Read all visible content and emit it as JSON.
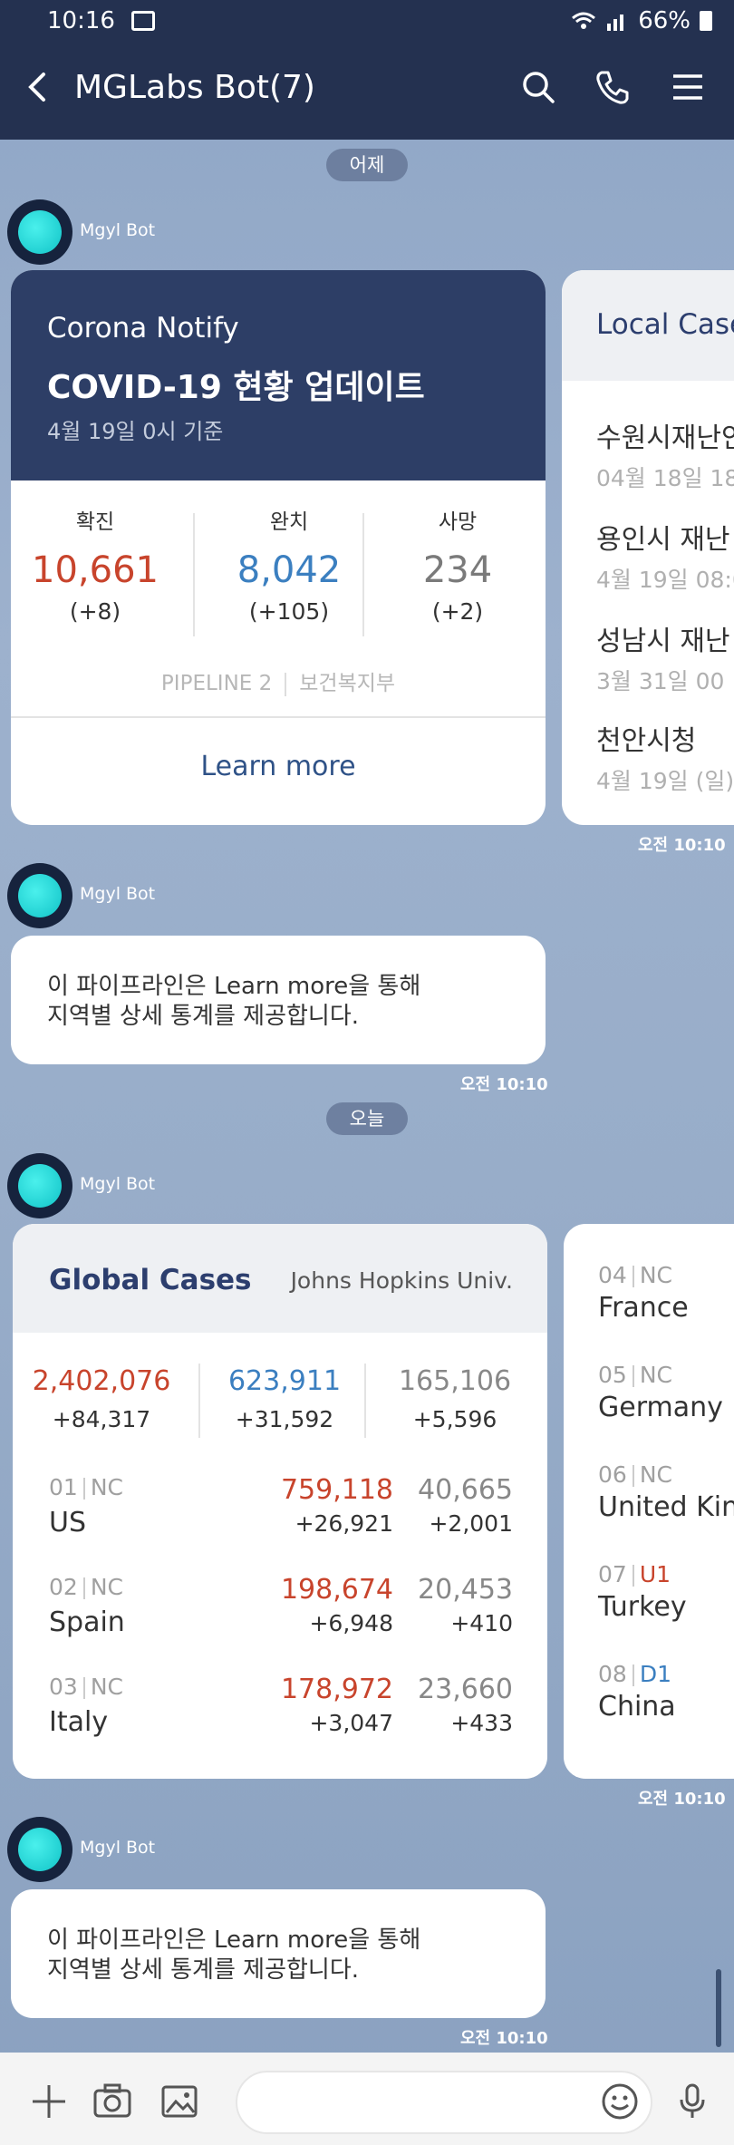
{
  "status_bar": {
    "time": "10:16",
    "battery": "66%"
  },
  "header": {
    "title": "MGLabs Bot(7)"
  },
  "dates": {
    "yesterday": "어제",
    "today": "오늘"
  },
  "sender_name": "Mgyl Bot",
  "corona_card": {
    "app": "Corona Notify",
    "headline": "COVID-19 현황 업데이트",
    "subtitle": "4월 19일 0시 기준",
    "stats": [
      {
        "label": "확진",
        "value": "10,661",
        "delta": "(+8)",
        "color": "#c8442c"
      },
      {
        "label": "완치",
        "value": "8,042",
        "delta": "(+105)",
        "color": "#3b7fc0"
      },
      {
        "label": "사망",
        "value": "234",
        "delta": "(+2)",
        "color": "#7a7a7a"
      }
    ],
    "footer_left": "PIPELINE 2",
    "footer_right": "보건복지부",
    "learn_more": "Learn more"
  },
  "local_card": {
    "title": "Local Case",
    "items": [
      {
        "name": "수원시재난안",
        "date": "04월 18일 18"
      },
      {
        "name": "용인시 재난",
        "date": "4월 19일 08:0"
      },
      {
        "name": "성남시 재난",
        "date": "3월 31일 00 :"
      },
      {
        "name": "천안시청",
        "date": "4월 19일 (일)"
      }
    ]
  },
  "message_text_line1": "이 파이프라인은 Learn more을 통해",
  "message_text_line2": "지역별 상세 통계를 제공합니다.",
  "timestamp": "오전 10:10",
  "global_card": {
    "title": "Global Cases",
    "source": "Johns Hopkins Univ.",
    "summary": [
      {
        "value": "2,402,076",
        "delta": "+84,317",
        "color": "#c8442c"
      },
      {
        "value": "623,911",
        "delta": "+31,592",
        "color": "#3b7fc0"
      },
      {
        "value": "165,106",
        "delta": "+5,596",
        "color": "#888888"
      }
    ],
    "rows": [
      {
        "rank": "01",
        "tag": "NC",
        "country": "US",
        "cases": "759,118",
        "cases_delta": "+26,921",
        "deaths": "40,665",
        "deaths_delta": "+2,001"
      },
      {
        "rank": "02",
        "tag": "NC",
        "country": "Spain",
        "cases": "198,674",
        "cases_delta": "+6,948",
        "deaths": "20,453",
        "deaths_delta": "+410"
      },
      {
        "rank": "03",
        "tag": "NC",
        "country": "Italy",
        "cases": "178,972",
        "cases_delta": "+3,047",
        "deaths": "23,660",
        "deaths_delta": "+433"
      }
    ]
  },
  "global_card_2": {
    "rows": [
      {
        "rank": "04",
        "tag": "NC",
        "country": "France",
        "tag_color": "#a0a0a0"
      },
      {
        "rank": "05",
        "tag": "NC",
        "country": "Germany",
        "tag_color": "#a0a0a0"
      },
      {
        "rank": "06",
        "tag": "NC",
        "country": "United Kin",
        "tag_color": "#a0a0a0"
      },
      {
        "rank": "07",
        "tag": "U1",
        "country": "Turkey",
        "tag_color": "#c8442c"
      },
      {
        "rank": "08",
        "tag": "D1",
        "country": "China",
        "tag_color": "#3b7fc0"
      }
    ]
  }
}
